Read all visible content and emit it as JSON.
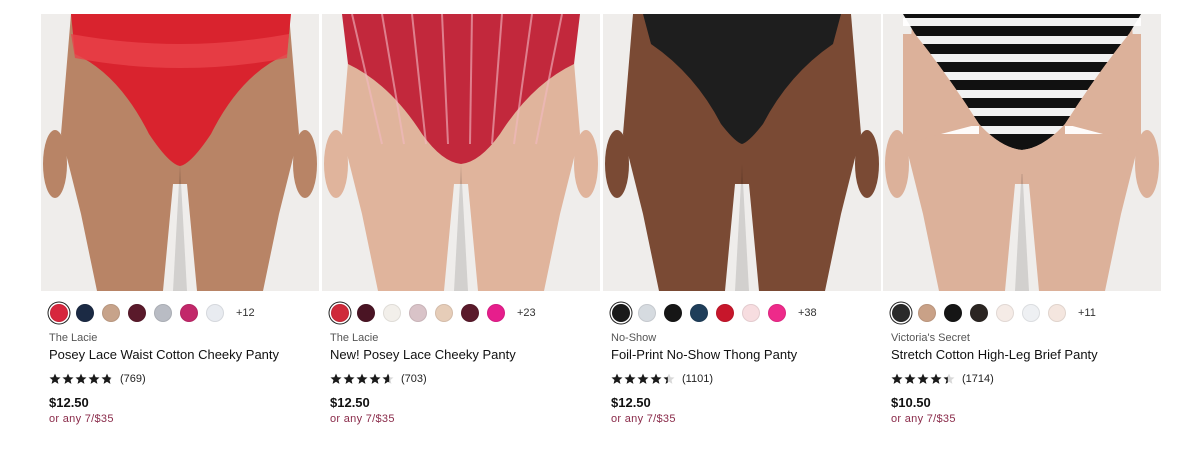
{
  "products": [
    {
      "collection": "The Lacie",
      "title": "Posey Lace Waist Cotton Cheeky Panty",
      "rating": 4.8,
      "reviews": "(769)",
      "price": "$12.50",
      "deal": "or any 7/$35",
      "more_colors": "+12",
      "swatches": [
        "#d7263d",
        "#1b2a44",
        "#c7a38a",
        "#5a1a2b",
        "#b9bcc4",
        "#c2286a",
        "#e8ebf0"
      ],
      "panty_color": "#d9232e",
      "skin": "#b88466"
    },
    {
      "collection": "The Lacie",
      "title": "New! Posey Lace Cheeky Panty",
      "rating": 4.6,
      "reviews": "(703)",
      "price": "$12.50",
      "deal": "or any 7/$35",
      "more_colors": "+23",
      "swatches": [
        "#cf2a3a",
        "#4a1424",
        "#f2efea",
        "#d9c3c8",
        "#e6cdb8",
        "#5a1a2b",
        "#e61e8c"
      ],
      "panty_color": "#c2283c",
      "skin": "#e0b49c"
    },
    {
      "collection": "No-Show",
      "title": "Foil-Print No-Show Thong Panty",
      "rating": 4.4,
      "reviews": "(1101)",
      "price": "$12.50",
      "deal": "or any 7/$35",
      "more_colors": "+38",
      "swatches": [
        "#1a1a1a",
        "#d6dbe0",
        "#161616",
        "#1f3e5a",
        "#c7162b",
        "#f7dde0",
        "#ee2a8a"
      ],
      "panty_color": "#1e1e1e",
      "skin": "#7a4a34"
    },
    {
      "collection": "Victoria's Secret",
      "title": "Stretch Cotton High-Leg Brief Panty",
      "rating": 4.4,
      "reviews": "(1714)",
      "price": "$10.50",
      "deal": "or any 7/$35",
      "more_colors": "+11",
      "swatches": [
        "#2a2a2a",
        "#c9a187",
        "#151515",
        "#2b2522",
        "#f5ebe6",
        "#eef0f3",
        "#f4e6df"
      ],
      "panty_color": "#111111",
      "skin": "#dcb19a"
    }
  ]
}
